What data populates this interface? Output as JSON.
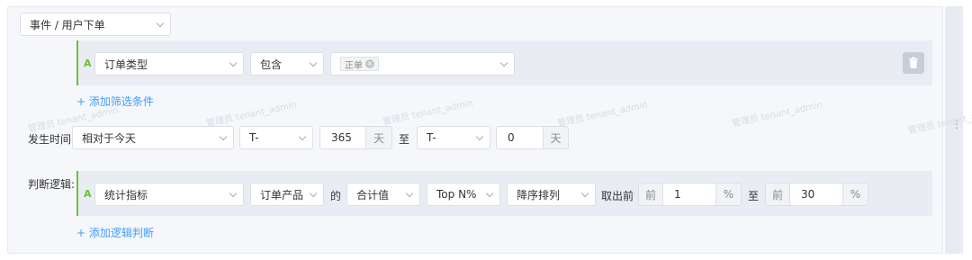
{
  "event_select": {
    "value": "事件 / 用户下单"
  },
  "filter": {
    "label_letter": "A",
    "field": "订单类型",
    "operator": "包含",
    "tag": "正单",
    "add_link": "+ 添加筛选条件",
    "delete_icon": "trash-icon"
  },
  "time": {
    "label": "发生时间:",
    "relative": "相对于今天",
    "start_prefix": "T-",
    "start_value": "365",
    "start_unit": "天",
    "to": "至",
    "end_prefix": "T-",
    "end_value": "0",
    "end_unit": "天"
  },
  "logic": {
    "label": "判断逻辑:",
    "label_letter": "A",
    "metric": "统计指标",
    "field": "订单产品",
    "of": "的",
    "agg": "合计值",
    "rank": "Top N%",
    "order": "降序排列",
    "take": "取出前",
    "from_prefix": "前",
    "from_value": "1",
    "from_unit": "%",
    "to": "至",
    "to_prefix": "前",
    "to_value": "30",
    "to_unit": "%",
    "add_link": "+ 添加逻辑判断"
  },
  "watermark": "管理员 tenant_admin",
  "colors": {
    "accent": "#409eff",
    "green": "#67c23a"
  }
}
